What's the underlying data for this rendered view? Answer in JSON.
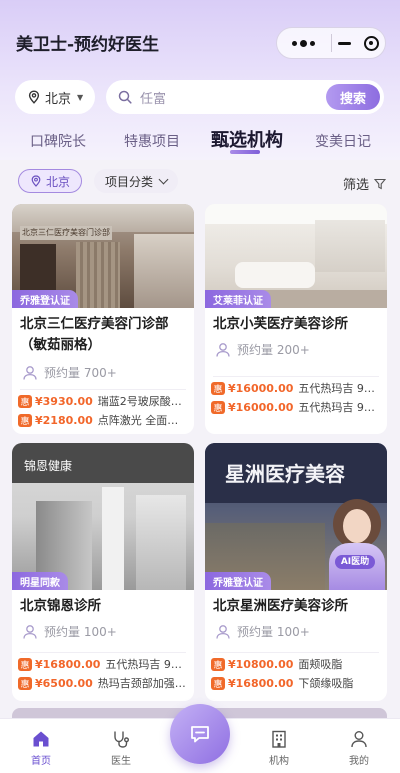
{
  "app": {
    "title": "美卫士-预约好医生"
  },
  "search": {
    "city": "北京",
    "placeholder": "任富",
    "button": "搜索"
  },
  "tabs": [
    {
      "label": "口碑院长"
    },
    {
      "label": "特惠项目"
    },
    {
      "label": "甄选机构"
    },
    {
      "label": "变美日记"
    }
  ],
  "active_tab_index": 2,
  "filters": {
    "city": "北京",
    "category": "项目分类",
    "screen": "筛选"
  },
  "cards": [
    {
      "badge": "乔雅登认证",
      "name": "北京三仁医疗美容门诊部（敏茹丽格）",
      "appt": "预约量 700+",
      "sign_text": "北京三仁医疗美容门诊部",
      "prices": [
        {
          "tag": "惠",
          "amount": "¥3930.00",
          "desc": "瑞蓝2号玻尿酸1m..."
        },
        {
          "tag": "惠",
          "amount": "¥2180.00",
          "desc": "点阵激光 全面部补..."
        }
      ]
    },
    {
      "badge": "艾莱菲认证",
      "name": "北京小芙医疗美容诊所",
      "appt": "预约量 200+",
      "prices": [
        {
          "tag": "惠",
          "amount": "¥16000.00",
          "desc": "五代热玛吉 900 ..."
        },
        {
          "tag": "惠",
          "amount": "¥16000.00",
          "desc": "五代热玛吉 900 ..."
        }
      ]
    },
    {
      "badge": "明星同款",
      "name": "北京锦恩诊所",
      "appt": "预约量 100+",
      "sign_text": "锦恩健康",
      "prices": [
        {
          "tag": "惠",
          "amount": "¥16800.00",
          "desc": "五代热玛吉 900 ..."
        },
        {
          "tag": "惠",
          "amount": "¥6500.00",
          "desc": "热玛吉颈部加强单..."
        }
      ]
    },
    {
      "badge": "乔雅登认证",
      "name": "北京星洲医疗美容诊所",
      "appt": "预约量 100+",
      "sign_text": "星洲医疗美容",
      "ai_label": "AI医助",
      "prices": [
        {
          "tag": "惠",
          "amount": "¥10800.00",
          "desc": "面颊吸脂"
        },
        {
          "tag": "惠",
          "amount": "¥16800.00",
          "desc": "下颌缘吸脂"
        }
      ]
    }
  ],
  "bottom_nav": [
    {
      "label": "首页",
      "icon": "home-icon"
    },
    {
      "label": "医生",
      "icon": "stethoscope-icon"
    },
    {
      "label": "机构",
      "icon": "building-icon"
    },
    {
      "label": "我的",
      "icon": "user-icon"
    }
  ],
  "colors": {
    "accent": "#8d6de0",
    "price": "#f2662a",
    "badge": "#9a78e4"
  }
}
